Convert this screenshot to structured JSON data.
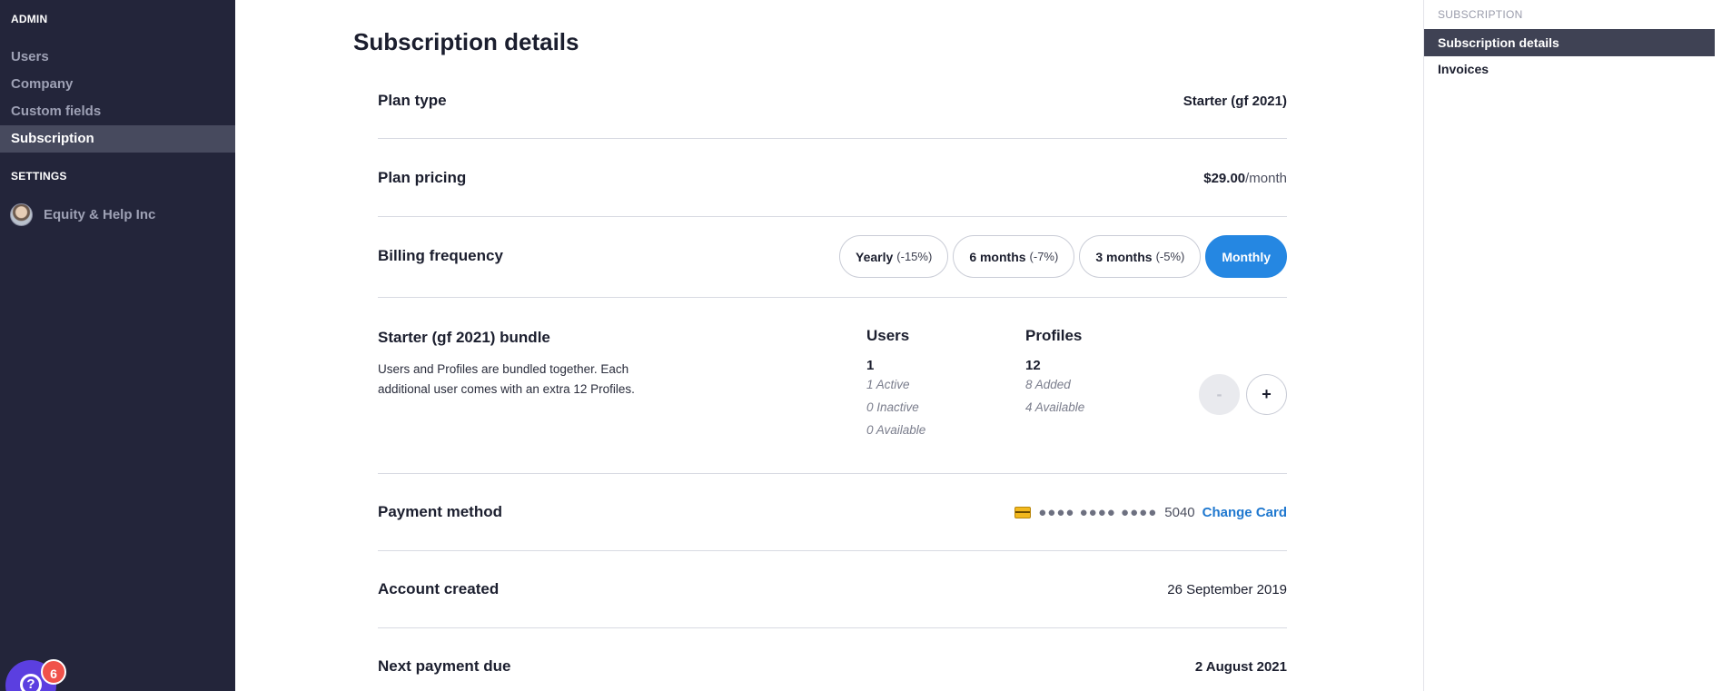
{
  "sidebar": {
    "admin_label": "ADMIN",
    "items": [
      {
        "label": "Users"
      },
      {
        "label": "Company"
      },
      {
        "label": "Custom fields"
      },
      {
        "label": "Subscription"
      }
    ],
    "settings_label": "SETTINGS",
    "org_name": "Equity & Help Inc",
    "help_badge_count": "6"
  },
  "main": {
    "title": "Subscription details",
    "plan_type": {
      "label": "Plan type",
      "value": "Starter (gf 2021)"
    },
    "plan_pricing": {
      "label": "Plan pricing",
      "amount": "$29.00",
      "period": "/month"
    },
    "billing": {
      "label": "Billing frequency",
      "options": [
        {
          "name": "Yearly",
          "discount": "(-15%)"
        },
        {
          "name": "6 months",
          "discount": "(-7%)"
        },
        {
          "name": "3 months",
          "discount": "(-5%)"
        },
        {
          "name": "Monthly",
          "discount": ""
        }
      ],
      "selected": "Monthly"
    },
    "bundle": {
      "title": "Starter (gf 2021) bundle",
      "description": "Users and Profiles are bundled together. Each additional user comes with an extra 12 Profiles.",
      "users": {
        "heading": "Users",
        "count": "1",
        "active": "1 Active",
        "inactive": "0 Inactive",
        "available": "0 Available"
      },
      "profiles": {
        "heading": "Profiles",
        "count": "12",
        "added": "8 Added",
        "available": "4 Available"
      },
      "minus_label": "-",
      "plus_label": "+"
    },
    "payment": {
      "label": "Payment method",
      "card_mask": "●●●● ●●●● ●●●●",
      "card_last4": "5040",
      "change_label": "Change Card"
    },
    "account_created": {
      "label": "Account created",
      "value": "26 September 2019"
    },
    "next_payment": {
      "label": "Next payment due",
      "value": "2 August 2021"
    }
  },
  "right_nav": {
    "section_label": "SUBSCRIPTION",
    "items": [
      {
        "label": "Subscription details"
      },
      {
        "label": "Invoices"
      }
    ]
  }
}
